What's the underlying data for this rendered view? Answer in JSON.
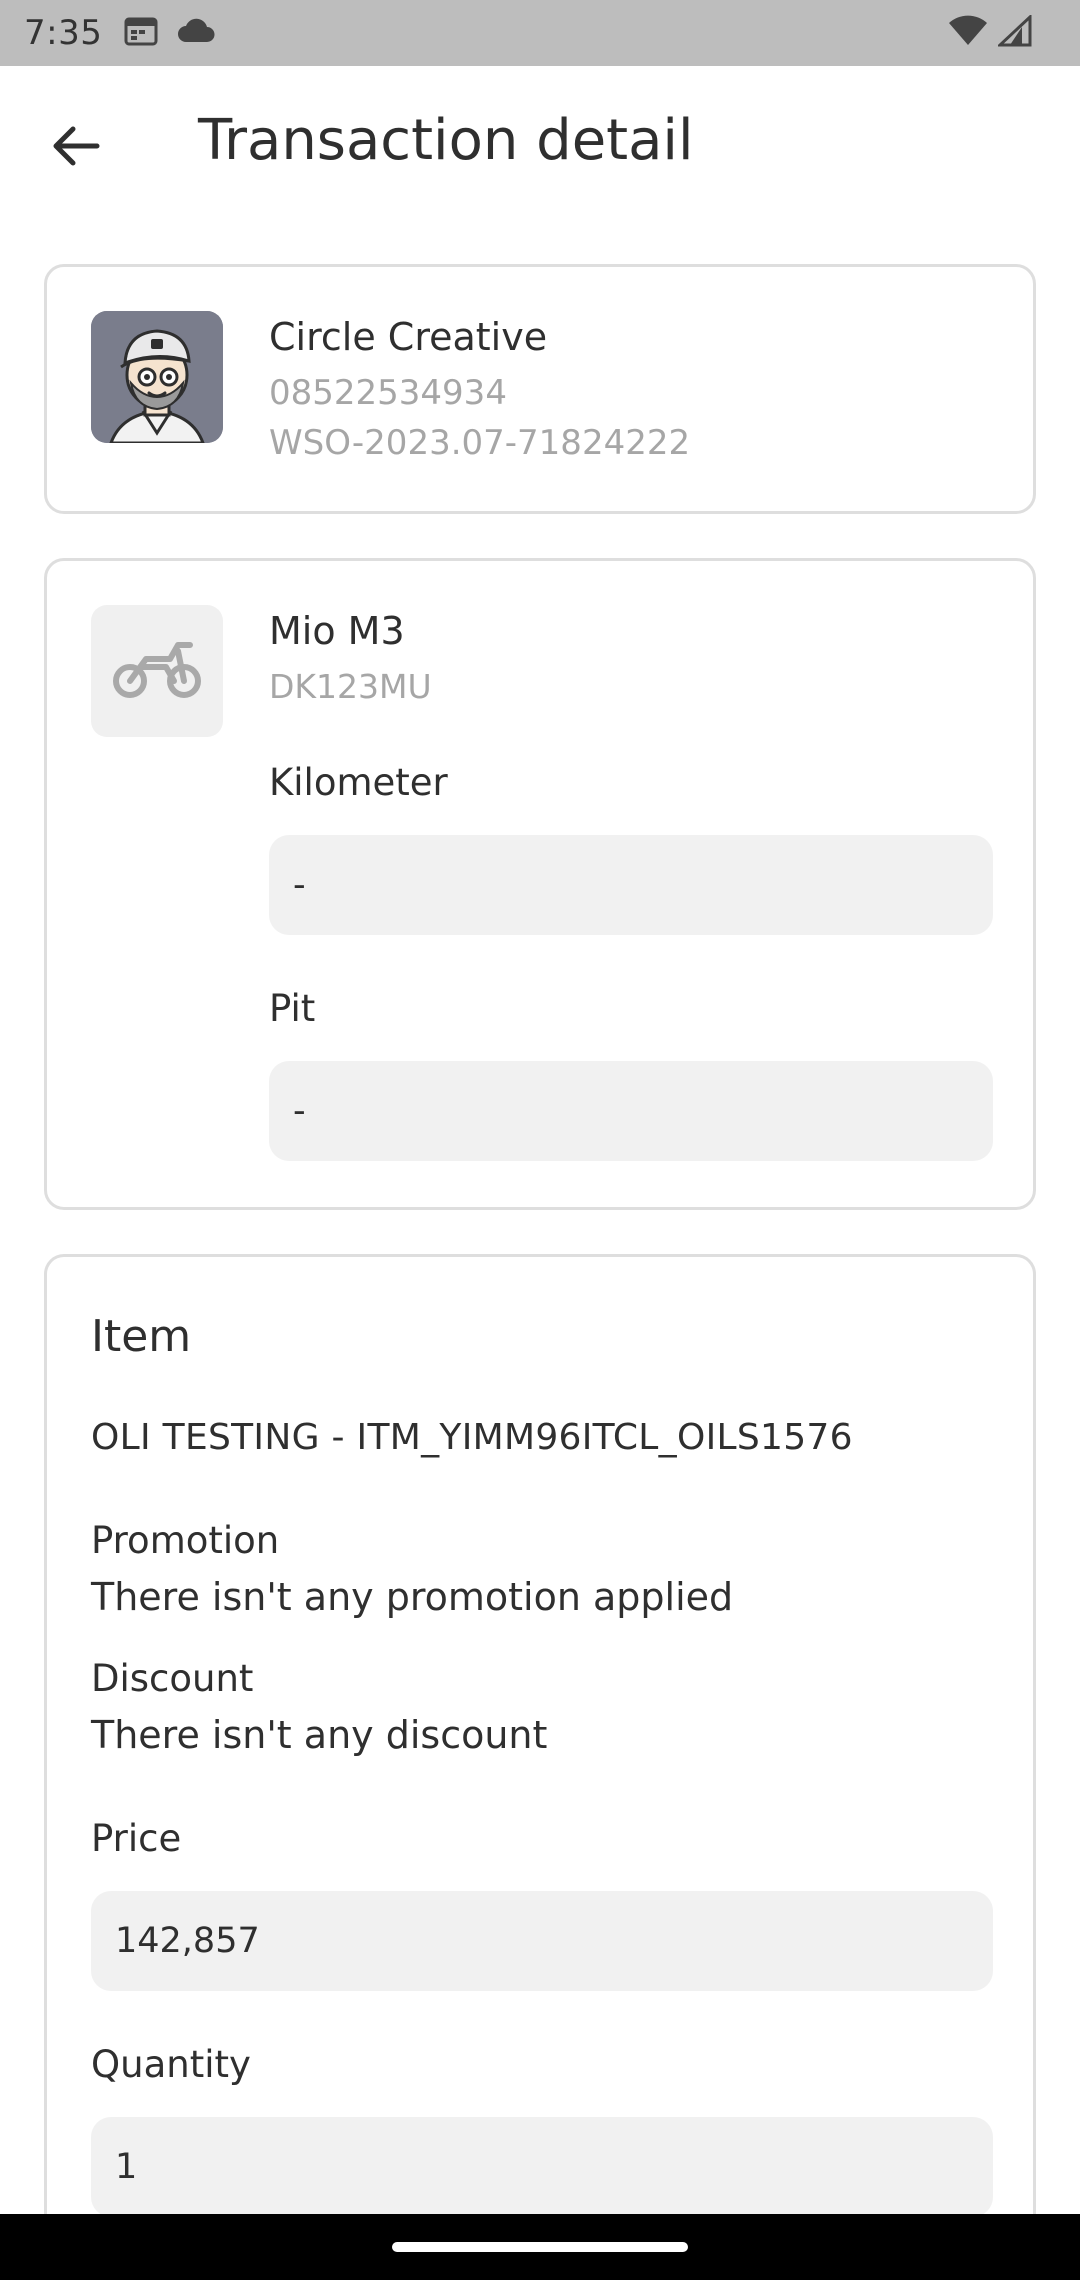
{
  "status_bar": {
    "time": "7:35",
    "icons": [
      "calendar-icon",
      "cloud-icon",
      "wifi-icon",
      "signal-icon"
    ]
  },
  "app_bar": {
    "back_icon": "arrow-left-icon",
    "title": "Transaction detail"
  },
  "customer": {
    "name": "Circle Creative",
    "phone": "08522534934",
    "order_code": "WSO-2023.07-71824222"
  },
  "vehicle": {
    "name": "Mio M3",
    "plate": "DK123MU",
    "kilometer_label": "Kilometer",
    "kilometer_value": "-",
    "pit_label": "Pit",
    "pit_value": "-"
  },
  "item": {
    "section_title": "Item",
    "code": "OLI TESTING - ITM_YIMM96ITCL_OILS1576",
    "promotion_label": "Promotion",
    "promotion_value": "There isn't any promotion applied",
    "discount_label": "Discount",
    "discount_value": "There isn't any discount",
    "price_label": "Price",
    "price_value": "142,857",
    "quantity_label": "Quantity",
    "quantity_value": "1"
  },
  "colors": {
    "status_bar_bg": "#bdbdbd",
    "card_border": "#dedede",
    "field_bg": "#f1f1f1",
    "muted_text": "#a6a6a6",
    "avatar_bg": "#7a7d8c"
  }
}
